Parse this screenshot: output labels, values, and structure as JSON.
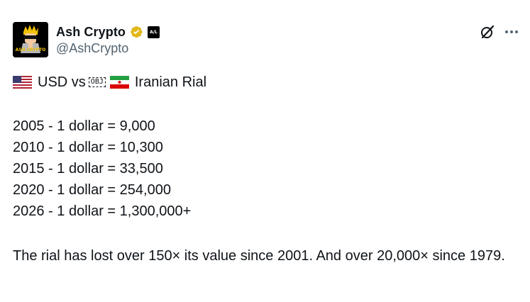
{
  "author": {
    "display_name": "Ash Crypto",
    "handle": "@AshCrypto",
    "verified_icon": "verified-badge-icon",
    "affiliate_badge": "A/L",
    "avatar_text": "ASH CRYPTO"
  },
  "actions": {
    "grok_icon": "grok-icon",
    "more_icon": "more-icon"
  },
  "post": {
    "headline_left": "USD vs",
    "headline_obj": "OBJ",
    "headline_right": "Iranian Rial",
    "lines": [
      "2005 - 1 dollar = 9,000",
      "2010 - 1 dollar = 10,300",
      "2015 - 1 dollar = 33,500",
      "2020 - 1 dollar = 254,000",
      "2026 - 1 dollar = 1,300,000+"
    ],
    "paragraph": "The rial has lost over 150× its value since 2001. And over 20,000× since 1979."
  },
  "colors": {
    "text": "#0f1419",
    "secondary": "#536471",
    "verified_gold": "#e2b719"
  }
}
